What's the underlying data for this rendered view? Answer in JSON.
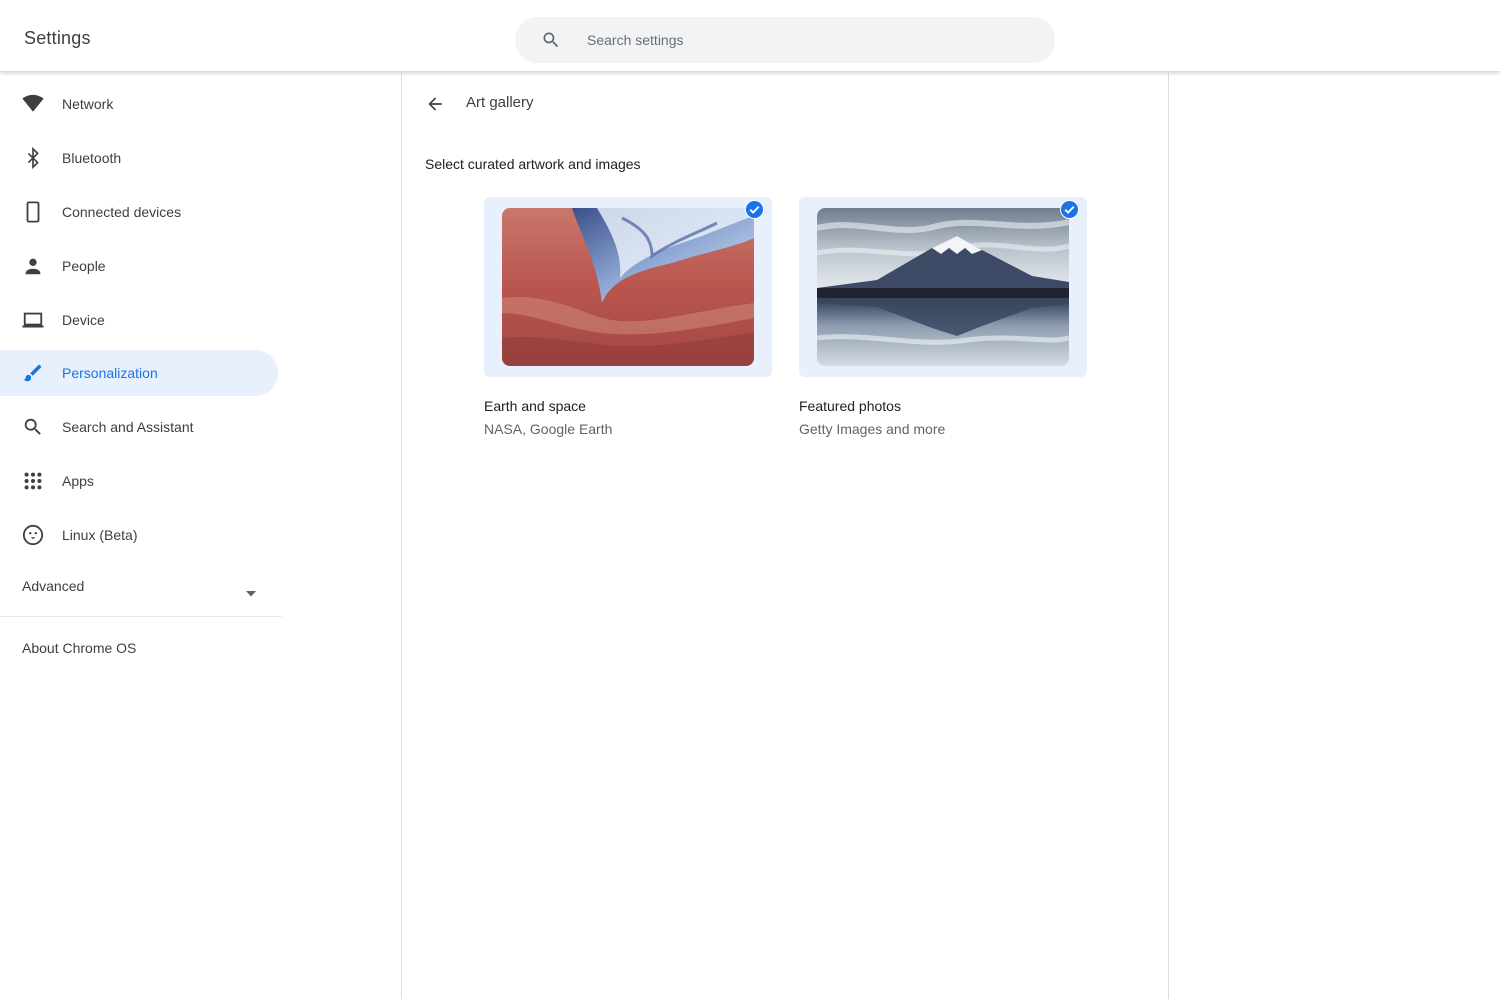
{
  "header": {
    "title": "Settings",
    "search_placeholder": "Search settings"
  },
  "sidebar": {
    "items": [
      {
        "label": "Network",
        "icon": "wifi-icon"
      },
      {
        "label": "Bluetooth",
        "icon": "bluetooth-icon"
      },
      {
        "label": "Connected devices",
        "icon": "phone-icon"
      },
      {
        "label": "People",
        "icon": "person-icon"
      },
      {
        "label": "Device",
        "icon": "laptop-icon"
      },
      {
        "label": "Personalization",
        "icon": "brush-icon",
        "active": true
      },
      {
        "label": "Search and Assistant",
        "icon": "search-icon"
      },
      {
        "label": "Apps",
        "icon": "apps-grid-icon"
      },
      {
        "label": "Linux (Beta)",
        "icon": "linux-penguin-icon"
      }
    ],
    "advanced_label": "Advanced",
    "about_label": "About Chrome OS"
  },
  "main": {
    "page_title": "Art gallery",
    "section_label": "Select curated artwork and images",
    "collections": [
      {
        "title": "Earth and space",
        "subtitle": "NASA, Google Earth",
        "selected": true
      },
      {
        "title": "Featured photos",
        "subtitle": "Getty Images and more",
        "selected": true
      }
    ]
  },
  "colors": {
    "accent": "#1a73e8",
    "active_bg": "#e8f0fe",
    "text_primary": "#202124",
    "text_secondary": "#5f6368"
  }
}
